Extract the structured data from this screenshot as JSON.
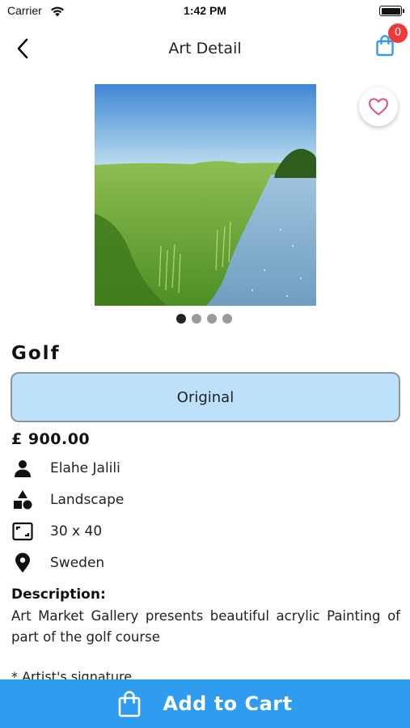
{
  "status_bar": {
    "carrier": "Carrier",
    "time": "1:42 PM"
  },
  "nav": {
    "title": "Art Detail",
    "cart_count": "0"
  },
  "artwork": {
    "title": "Golf",
    "type": "Original",
    "price": "£ 900.00",
    "artist": "Elahe Jalili",
    "category": "Landscape",
    "size": "30 x 40",
    "location": "Sweden",
    "description_heading": "Description:",
    "description": "Art Market Gallery presents beautiful acrylic Painting of part of the golf course",
    "description_extra": "* Artist's signature"
  },
  "carousel": {
    "image_count": 4,
    "active_index": 0
  },
  "actions": {
    "add_to_cart": "Add to Cart"
  },
  "colors": {
    "accent": "#2f9cf0",
    "badge": "#f03a3a",
    "type_fill": "#bde0fb",
    "heart": "#e0507a"
  }
}
